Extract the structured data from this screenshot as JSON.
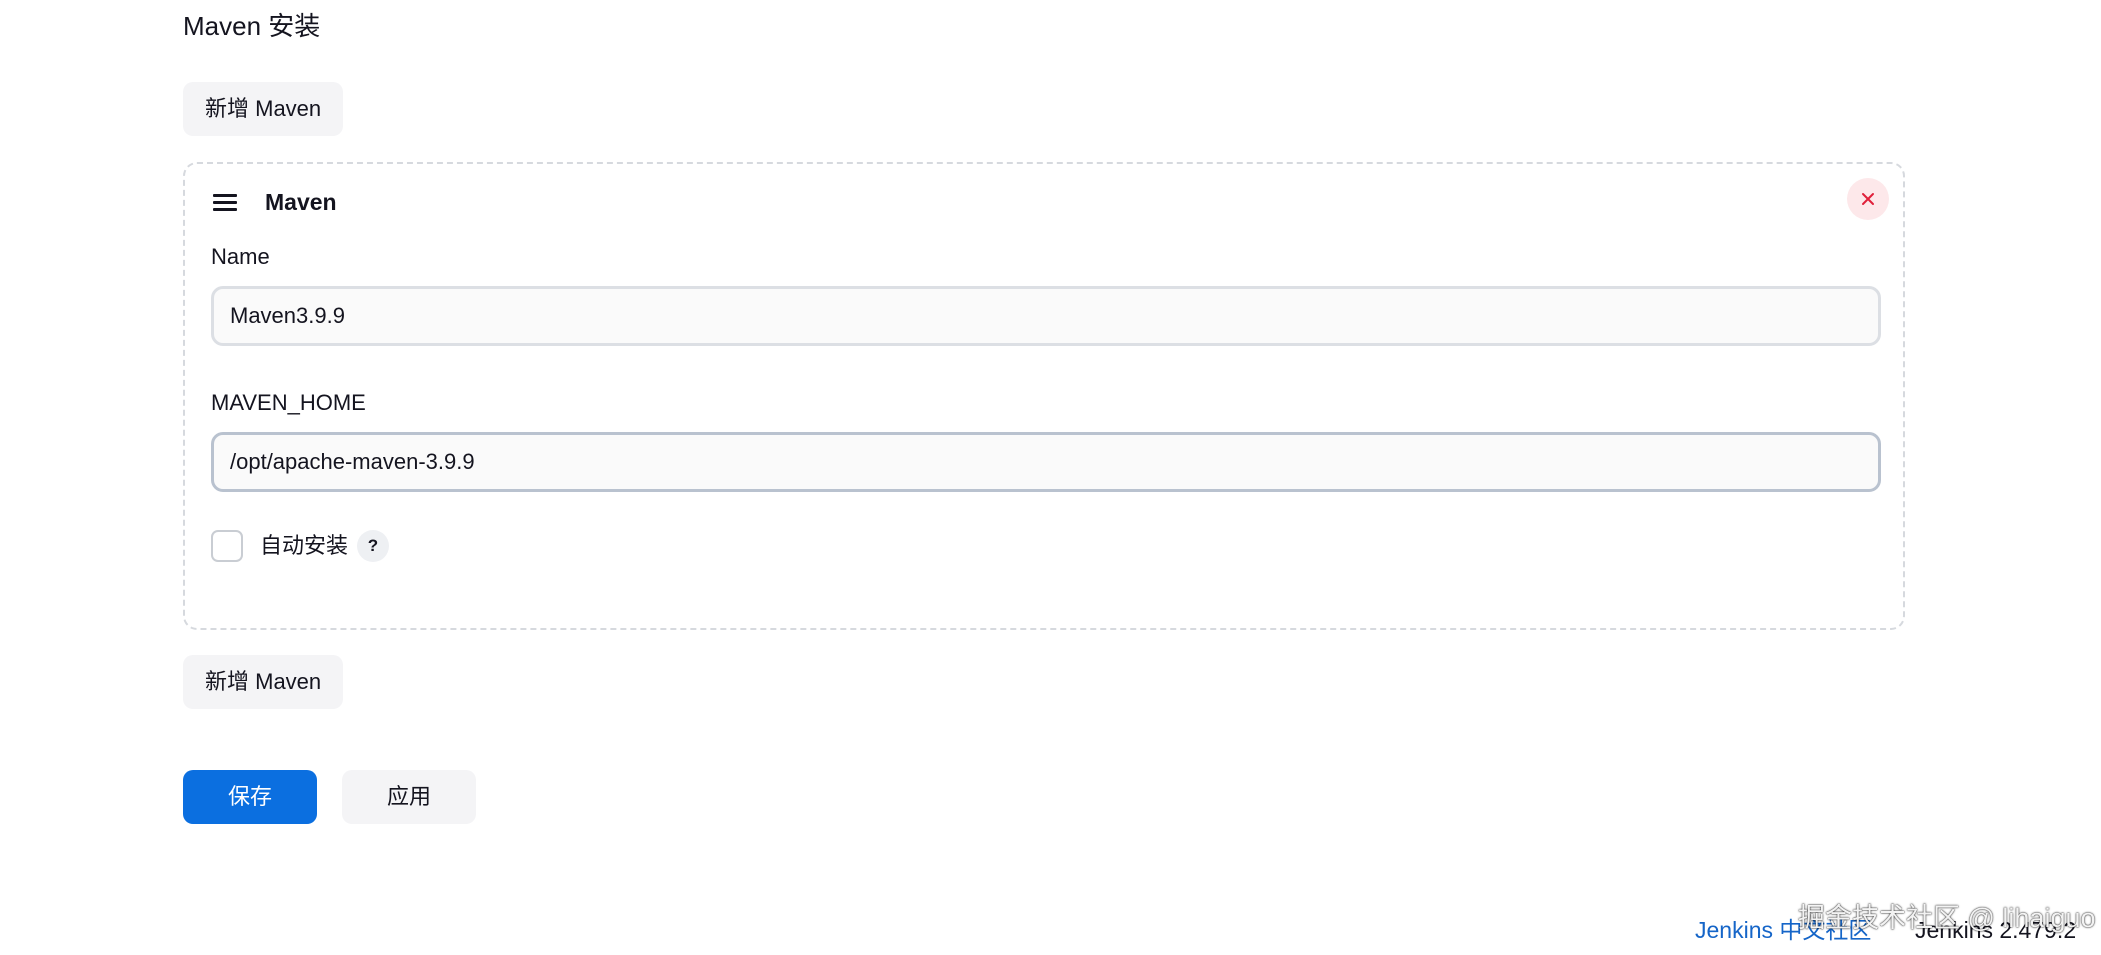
{
  "section": {
    "title": "Maven 安装",
    "add_button_label": "新增 Maven"
  },
  "installation": {
    "title": "Maven",
    "name_label": "Name",
    "name_value": "Maven3.9.9",
    "home_label": "MAVEN_HOME",
    "home_value": "/opt/apache-maven-3.9.9",
    "auto_install_label": "自动安装",
    "auto_install_checked": false,
    "help_label": "?",
    "close_icon_color": "#e0203a"
  },
  "actions": {
    "save_label": "保存",
    "apply_label": "应用",
    "primary_color": "#0b6fe0"
  },
  "footer": {
    "community_link": "Jenkins 中文社区",
    "version": "Jenkins 2.479.2",
    "watermark": "掘金技术社区 @ lihaiguo"
  }
}
